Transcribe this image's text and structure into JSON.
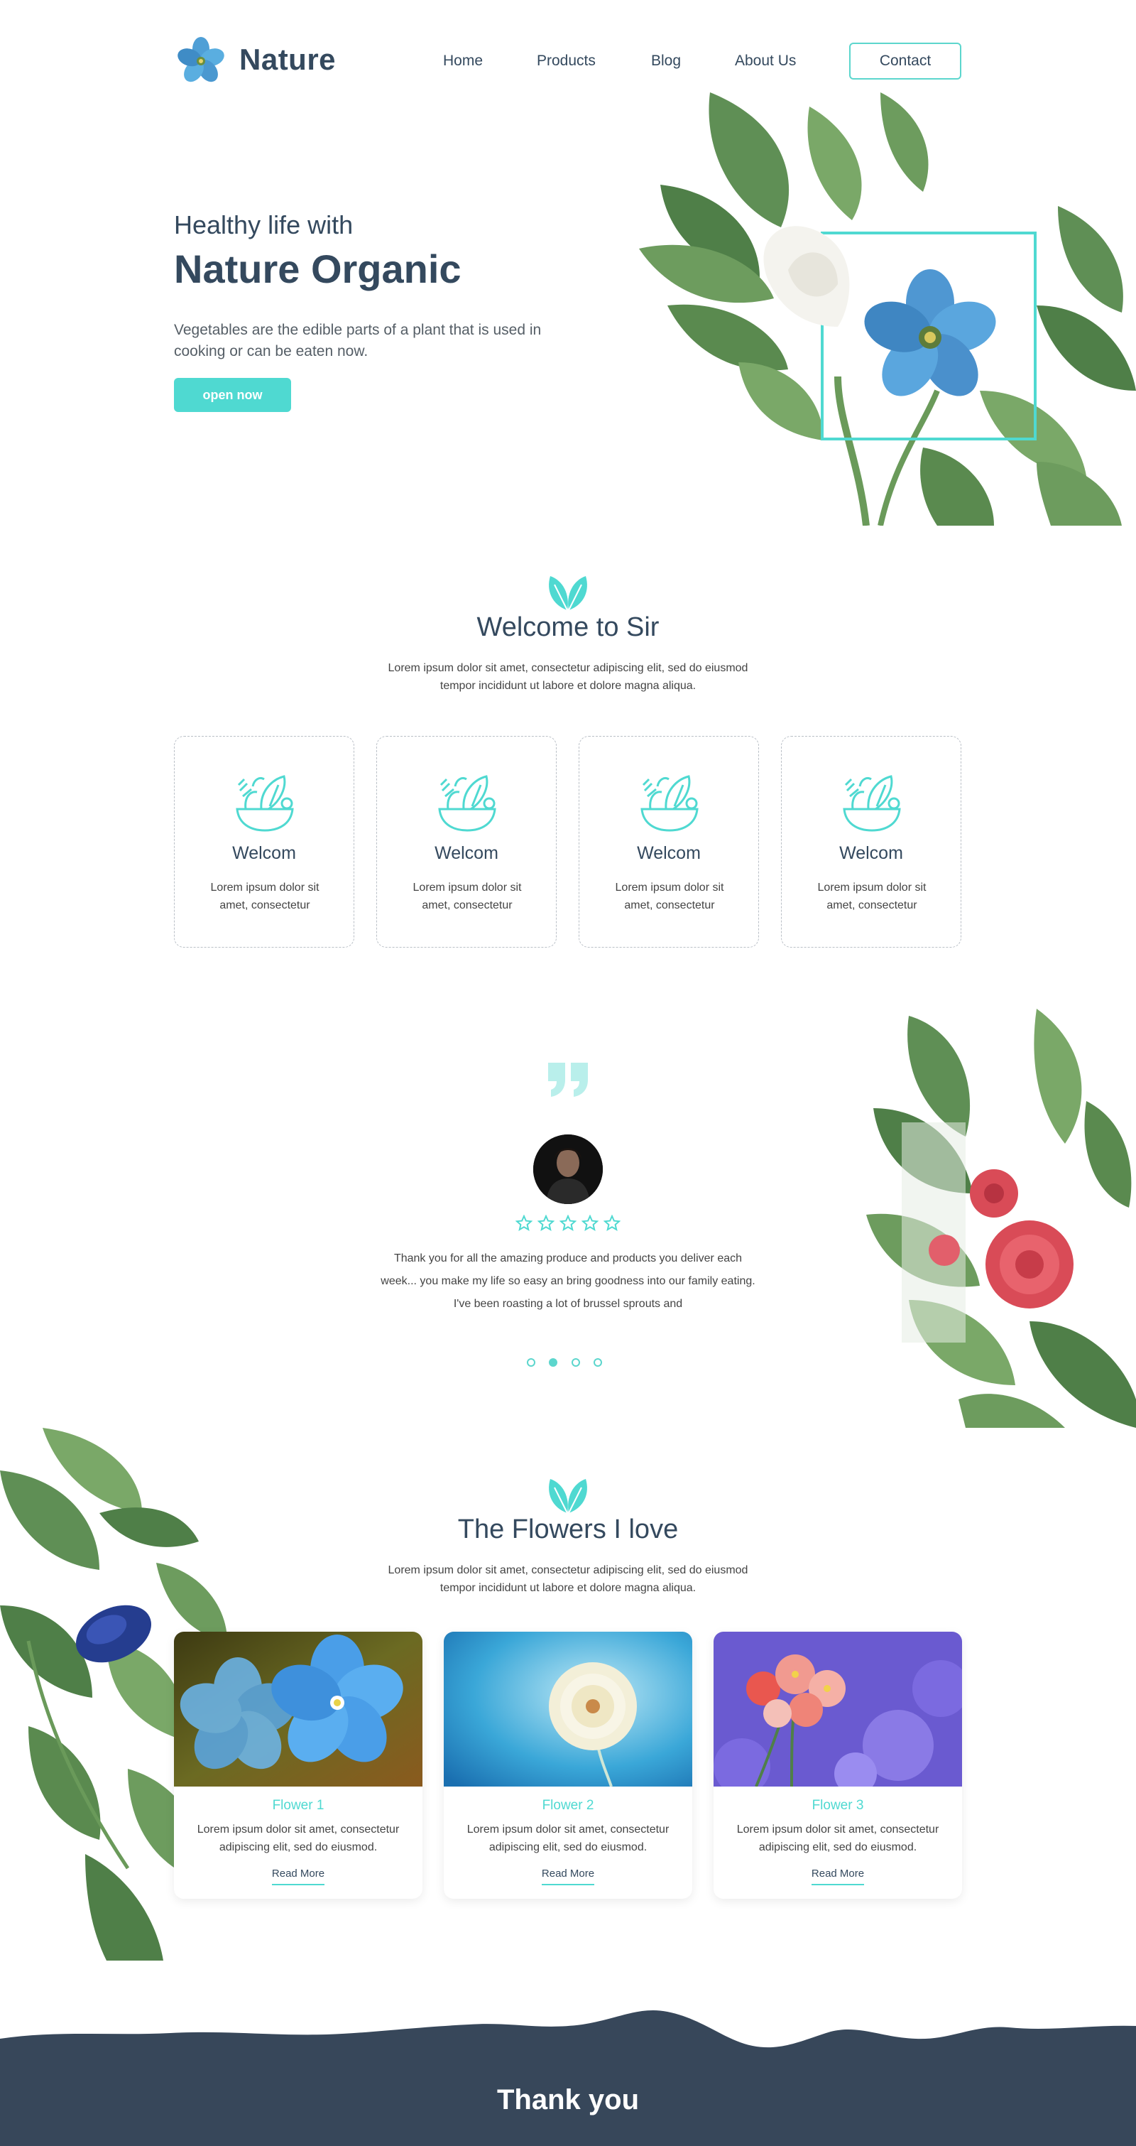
{
  "header": {
    "logo_text": "Nature",
    "nav": [
      {
        "label": "Home"
      },
      {
        "label": "Products"
      },
      {
        "label": "Blog"
      },
      {
        "label": "About Us"
      }
    ],
    "contact_label": "Contact"
  },
  "hero": {
    "subtitle": "Healthy life with",
    "title": "Nature Organic",
    "description": "Vegetables are the edible parts of a plant that is used in cooking or can be eaten now.",
    "button_label": "open now"
  },
  "welcome": {
    "title": "Welcome to Sir",
    "description": "Lorem ipsum dolor sit amet, consectetur adipiscing elit, sed do eiusmod tempor incididunt ut labore et dolore magna aliqua.",
    "cards": [
      {
        "title": "Welcom",
        "text": "Lorem ipsum dolor sit amet, consectetur",
        "icon": "salad-bowl-icon"
      },
      {
        "title": "Welcom",
        "text": "Lorem ipsum dolor sit amet, consectetur",
        "icon": "salad-bowl-icon"
      },
      {
        "title": "Welcom",
        "text": "Lorem ipsum dolor sit amet, consectetur",
        "icon": "salad-bowl-icon"
      },
      {
        "title": "Welcom",
        "text": "Lorem ipsum dolor sit amet, consectetur",
        "icon": "salad-bowl-icon"
      }
    ]
  },
  "testimonial": {
    "quote_icon": "quote-icon",
    "rating_stars": 5,
    "text": "Thank you for all the amazing produce and products you deliver each week... you make my life so easy an bring goodness into our family eating. I've been roasting a lot of brussel sprouts and",
    "slides": 4,
    "active_slide": 2
  },
  "flowers": {
    "title": "The Flowers I love",
    "description": "Lorem ipsum dolor sit amet, consectetur adipiscing elit, sed do eiusmod tempor incididunt ut labore et dolore magna aliqua.",
    "items": [
      {
        "title": "Flower 1",
        "text": "Lorem ipsum dolor sit amet, consectetur adipiscing elit, sed do eiusmod.",
        "link": "Read More"
      },
      {
        "title": "Flower 2",
        "text": "Lorem ipsum dolor sit amet, consectetur adipiscing elit, sed do eiusmod.",
        "link": "Read More"
      },
      {
        "title": "Flower 3",
        "text": "Lorem ipsum dolor sit amet, consectetur adipiscing elit, sed do eiusmod.",
        "link": "Read More"
      }
    ]
  },
  "footer": {
    "text": "Thank you"
  },
  "colors": {
    "accent": "#4fd9d1",
    "text": "#34495e",
    "footer_bg": "#37475a"
  }
}
